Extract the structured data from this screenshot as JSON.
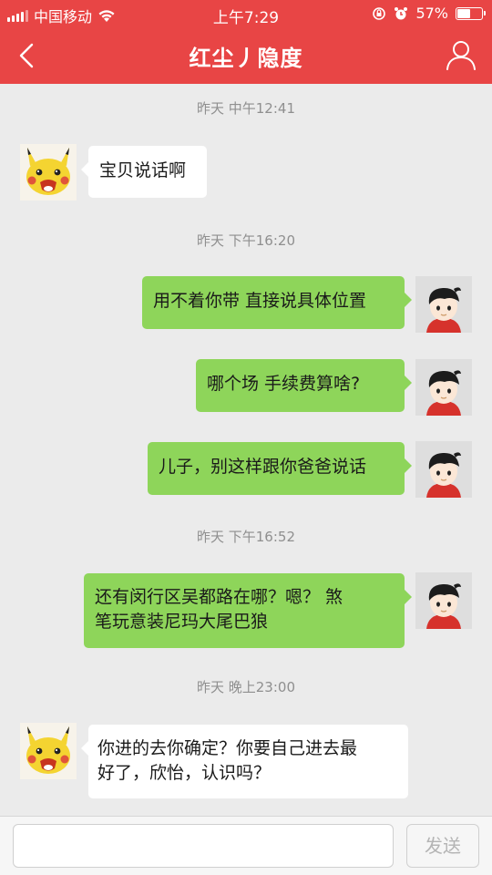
{
  "status_bar": {
    "carrier": "中国移动",
    "time": "上午7:29",
    "battery": "57%",
    "battery_level": 0.57
  },
  "header": {
    "title": "红尘丿隐度",
    "back_icon": "chevron-left-icon",
    "profile_icon": "person-icon"
  },
  "colors": {
    "header": "#e84545",
    "bubble_out": "#8ed55a",
    "bubble_in": "#ffffff",
    "background": "#ebebeb"
  },
  "messages": [
    {
      "type": "time",
      "text": "昨天 中午12:41"
    },
    {
      "type": "msg",
      "side": "in",
      "text": "宝贝说话啊"
    },
    {
      "type": "time",
      "text": "昨天 下午16:20"
    },
    {
      "type": "msg",
      "side": "out",
      "text": "用不着你带 直接说具体位置"
    },
    {
      "type": "msg",
      "side": "out",
      "text": "哪个场 手续费算啥?"
    },
    {
      "type": "msg",
      "side": "out",
      "text": "儿子，别这样跟你爸爸说话"
    },
    {
      "type": "time",
      "text": "昨天 下午16:52"
    },
    {
      "type": "msg",
      "side": "out",
      "line1": "还有闵行区吴都路在哪？嗯？ 煞",
      "line2": "笔玩意装尼玛大尾巴狼"
    },
    {
      "type": "time",
      "text": "昨天 晚上23:00"
    },
    {
      "type": "msg",
      "side": "in",
      "line1": "你进的去你确定？你要自己进去最",
      "line2": "好了，欣怡，认识吗？"
    }
  ],
  "input": {
    "value": "",
    "send_label": "发送"
  }
}
